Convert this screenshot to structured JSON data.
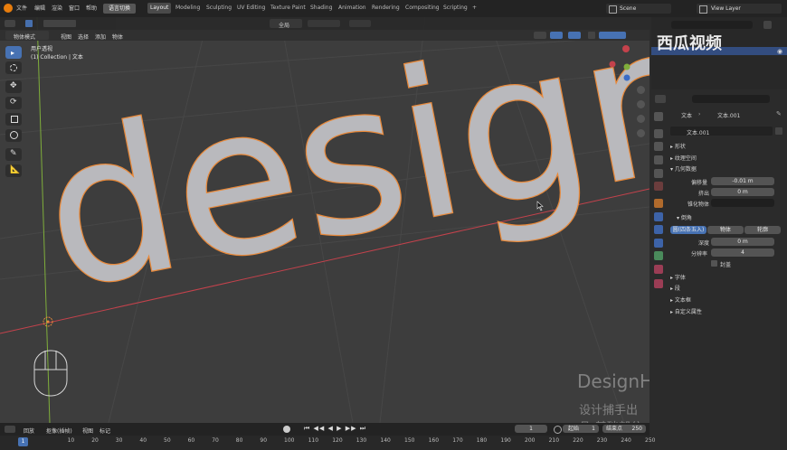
{
  "topbar": {
    "menus": [
      "文件",
      "编辑",
      "渲染",
      "窗口",
      "帮助"
    ],
    "lang_button": "语言切换",
    "workspaces": [
      "Layout",
      "Modeling",
      "Sculpting",
      "UV Editing",
      "Texture Paint",
      "Shading",
      "Animation",
      "Rendering",
      "Compositing",
      "Scripting"
    ],
    "active_workspace": "Layout",
    "add_workspace": "+",
    "scene_label": "Scene",
    "view_layer_label": "View Layer"
  },
  "viewport_header": {
    "mode": "物体模式",
    "menus": [
      "视图",
      "选择",
      "添加",
      "物体"
    ],
    "transform_orientation": "全局"
  },
  "overlay": {
    "view_name": "用户透视",
    "collection": "(1) Collection | 文本"
  },
  "scene_text": "design",
  "watermark": {
    "logo": "西瓜视频",
    "title": "DesignHunting",
    "subtitle": "设计捕手出品-基础部分"
  },
  "properties": {
    "breadcrumb_object": "文本",
    "breadcrumb_data": "文本.001",
    "datablock": "文本.001",
    "sections": {
      "shape": "形状",
      "texture_space": "纹理空间",
      "geometry": "几何数据",
      "bevel": "倒角",
      "font": "字体",
      "paragraph": "段",
      "text_box": "文本框",
      "custom_props": "自定义属性"
    },
    "geometry": {
      "offset_label": "偏移量",
      "offset_value": "-0.01 m",
      "extrude_label": "挤出",
      "extrude_value": "0 m",
      "taper_label": "锥化物体"
    },
    "bevel": {
      "tabs": [
        "圆(四条五入)",
        "物体",
        "轮廓"
      ],
      "depth_label": "深度",
      "depth_value": "0 m",
      "resolution_label": "分辨率",
      "resolution_value": "4",
      "fill_caps_label": "封盖"
    }
  },
  "timeline": {
    "menus": [
      "回放",
      "抠像(插帧)",
      "视图",
      "标记"
    ],
    "current_frame": "1",
    "start_label": "起始",
    "start_value": "1",
    "end_label": "结束点",
    "end_value": "250",
    "ruler": [
      "0",
      "10",
      "20",
      "30",
      "40",
      "50",
      "60",
      "70",
      "80",
      "90",
      "100",
      "110",
      "120",
      "130",
      "140",
      "150",
      "160",
      "170",
      "180",
      "190",
      "200",
      "210",
      "220",
      "230",
      "240",
      "250"
    ],
    "playhead": "1"
  },
  "colors": {
    "accent": "#4772b3",
    "outline": "#e8893a",
    "text_mesh": "#b9b9bd",
    "viewport_bg": "#3d3d3d",
    "x_axis": "#c4424c",
    "y_axis": "#7fae3b"
  }
}
